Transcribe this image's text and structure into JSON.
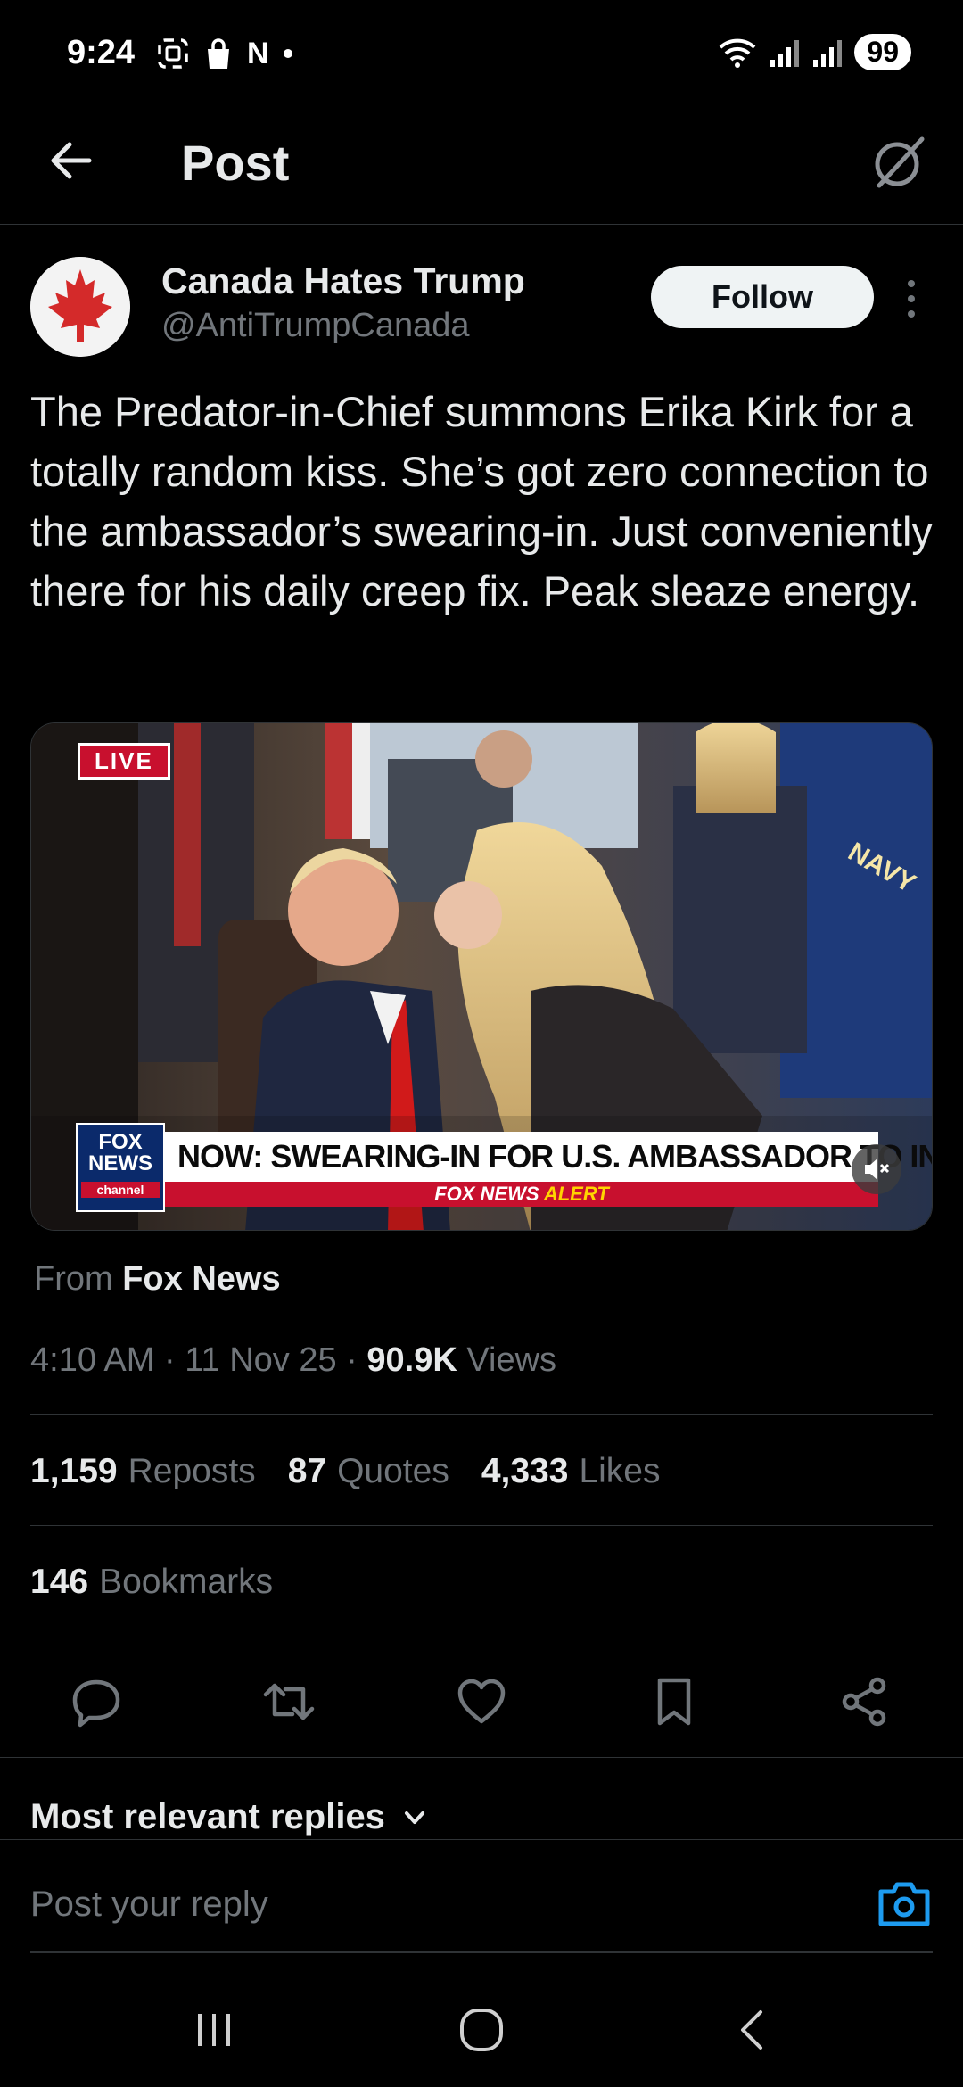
{
  "status_bar": {
    "time": "9:24",
    "left_icons": [
      "screenshot-icon",
      "shopping-bag-icon",
      "netflix-n-icon",
      "dot-icon"
    ],
    "netflix_letter": "N",
    "battery": "99"
  },
  "header": {
    "title": "Post"
  },
  "post": {
    "author_name": "Canada Hates Trump",
    "author_handle": "@AntiTrumpCanada",
    "follow_label": "Follow",
    "text": "The Predator-in-Chief summons Erika Kirk for a totally random kiss. She’s got zero connection to the ambassador’s swearing-in. Just conveniently there for his daily creep fix. Peak sleaze energy.",
    "media": {
      "live_label": "LIVE",
      "fox_logo_line1": "FOX",
      "fox_logo_line2": "NEWS",
      "fox_logo_line3": "channel",
      "ticker_headline": "NOW: SWEARING-IN FOR U.S. AMBASSADOR TO INDIA",
      "ticker_sub_brand": "FOX NEWS",
      "ticker_sub_alert": "ALERT",
      "flag_label": "NAVY"
    },
    "source_prefix": "From",
    "source_name": "Fox News",
    "time": "4:10 AM",
    "date": "11 Nov 25",
    "views_count": "90.9K",
    "views_label": "Views",
    "separator": "·",
    "reposts_count": "1,159",
    "reposts_label": "Reposts",
    "quotes_count": "87",
    "quotes_label": "Quotes",
    "likes_count": "4,333",
    "likes_label": "Likes",
    "bookmarks_count": "146",
    "bookmarks_label": "Bookmarks"
  },
  "replies": {
    "sort_label": "Most relevant replies"
  },
  "composer": {
    "placeholder": "Post your reply"
  },
  "colors": {
    "background": "#000000",
    "text_primary": "#e7e9ea",
    "text_secondary": "#71767b",
    "divider": "#2f3336",
    "accent_blue": "#1d9bf0",
    "follow_bg": "#eff3f4"
  }
}
